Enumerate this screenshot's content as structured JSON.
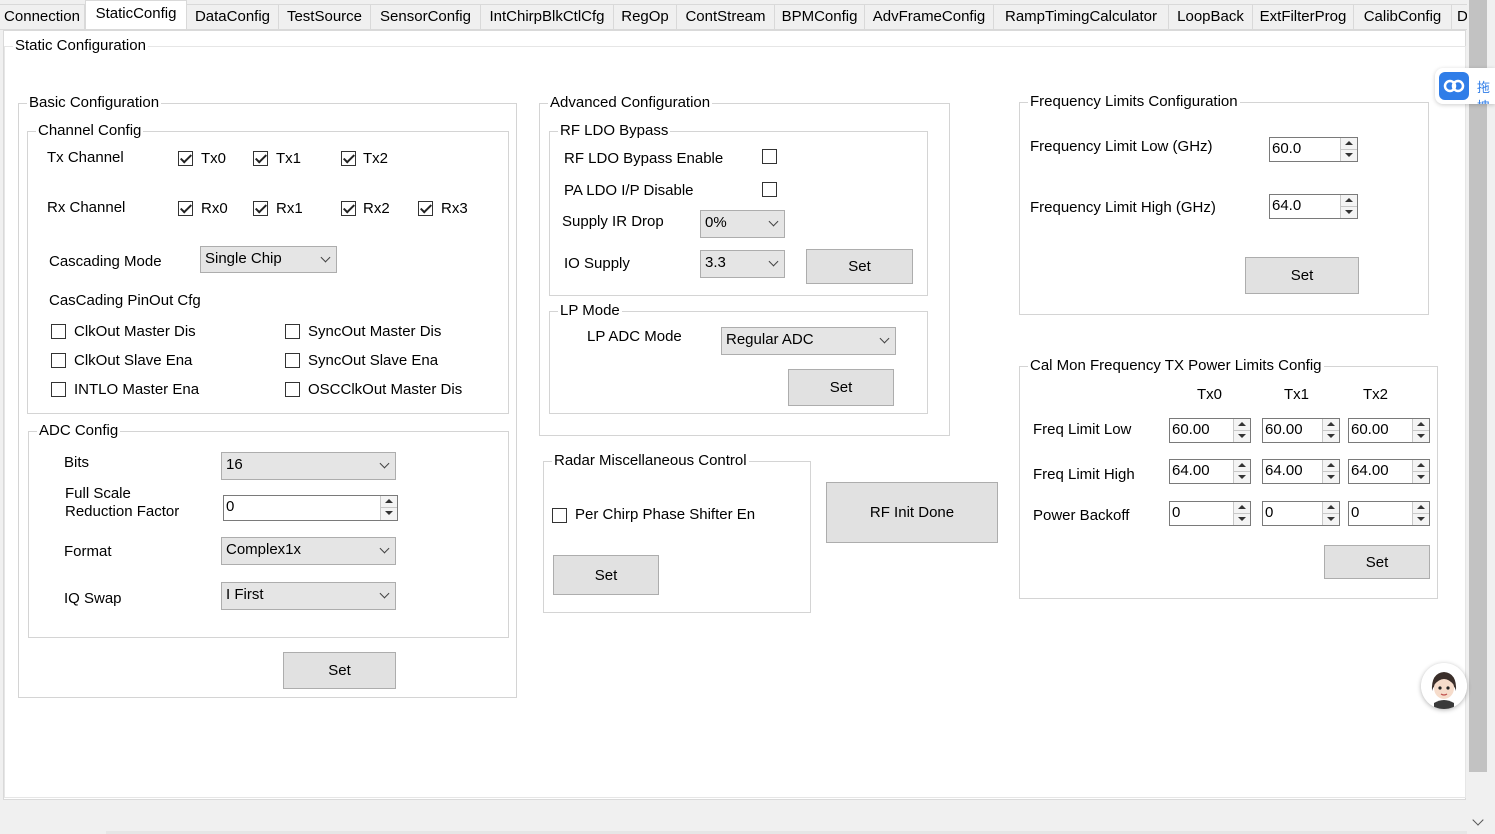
{
  "tabs": [
    "Connection",
    "StaticConfig",
    "DataConfig",
    "TestSource",
    "SensorConfig",
    "IntChirpBlkCtlCfg",
    "RegOp",
    "ContStream",
    "BPMConfig",
    "AdvFrameConfig",
    "RampTimingCalculator",
    "LoopBack",
    "ExtFilterProg",
    "CalibConfig",
    "D"
  ],
  "active_tab": "StaticConfig",
  "static_title": "Static Configuration",
  "basic": {
    "title": "Basic Configuration",
    "channel": {
      "title": "Channel Config",
      "tx_label": "Tx Channel",
      "tx": [
        {
          "label": "Tx0",
          "checked": true
        },
        {
          "label": "Tx1",
          "checked": true
        },
        {
          "label": "Tx2",
          "checked": true
        }
      ],
      "rx_label": "Rx Channel",
      "rx": [
        {
          "label": "Rx0",
          "checked": true
        },
        {
          "label": "Rx1",
          "checked": true
        },
        {
          "label": "Rx2",
          "checked": true
        },
        {
          "label": "Rx3",
          "checked": true
        }
      ],
      "cascading_label": "Cascading Mode",
      "cascading_value": "Single Chip",
      "pinout_label": "CasCading PinOut Cfg",
      "pinout": [
        "ClkOut Master Dis",
        "SyncOut Master Dis",
        "ClkOut Slave Ena",
        "SyncOut Slave Ena",
        "INTLO Master Ena",
        "OSCClkOut Master Dis"
      ]
    },
    "adc": {
      "title": "ADC Config",
      "bits_label": "Bits",
      "bits_value": "16",
      "fullscale_label_1": "Full Scale",
      "fullscale_label_2": "Reduction Factor",
      "fullscale_value": "0",
      "format_label": "Format",
      "format_value": "Complex1x",
      "iqswap_label": "IQ Swap",
      "iqswap_value": "I First"
    },
    "set": "Set"
  },
  "advanced": {
    "title": "Advanced Configuration",
    "rfldo": {
      "title": "RF LDO Bypass",
      "bypass_enable": "RF LDO Bypass Enable",
      "paldo_disable": "PA LDO I/P Disable",
      "supply_ir_label": "Supply IR Drop",
      "supply_ir_value": "0%",
      "io_supply_label": "IO Supply",
      "io_supply_value": "3.3",
      "set": "Set"
    },
    "lp": {
      "title": "LP Mode",
      "adc_mode_label": "LP ADC Mode",
      "adc_mode_value": "Regular ADC",
      "set": "Set"
    }
  },
  "radar_misc": {
    "title": "Radar Miscellaneous Control",
    "phase_shifter": "Per Chirp Phase Shifter En",
    "set": "Set"
  },
  "rf_init_done": "RF Init Done",
  "freq_limits": {
    "title": "Frequency Limits Configuration",
    "low_label": "Frequency Limit Low (GHz)",
    "low_value": "60.0",
    "high_label": "Frequency Limit High (GHz)",
    "high_value": "64.0",
    "set": "Set"
  },
  "calmon": {
    "title": "Cal Mon Frequency TX Power Limits Config",
    "cols": [
      "Tx0",
      "Tx1",
      "Tx2"
    ],
    "freq_low_label": "Freq Limit Low",
    "freq_low": [
      "60.00",
      "60.00",
      "60.00"
    ],
    "freq_high_label": "Freq Limit High",
    "freq_high": [
      "64.00",
      "64.00",
      "64.00"
    ],
    "backoff_label": "Power Backoff",
    "backoff": [
      "0",
      "0",
      "0"
    ],
    "set": "Set"
  },
  "cloud_widget_text": "拖拽"
}
